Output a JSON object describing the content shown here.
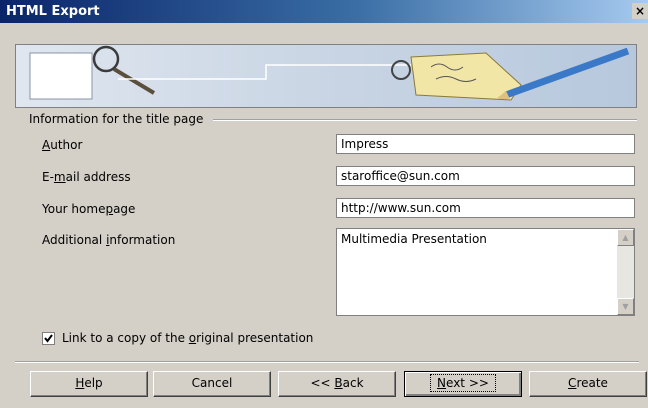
{
  "window": {
    "title": "HTML Export",
    "close_glyph": "×"
  },
  "group": {
    "label": "Information for the title page"
  },
  "fields": {
    "author": {
      "label_accel": "A",
      "label_rest": "uthor",
      "value": "Impress"
    },
    "email": {
      "label_pre": "E-",
      "label_accel": "m",
      "label_rest": "ail address",
      "value": "staroffice@sun.com"
    },
    "homepage": {
      "label_pre": "Your home",
      "label_accel": "p",
      "label_rest": "age",
      "value": "http://www.sun.com"
    },
    "additional": {
      "label_pre": "Additional ",
      "label_accel": "i",
      "label_rest": "nformation",
      "value": "Multimedia Presentation"
    }
  },
  "link_checkbox": {
    "checked": true,
    "label_pre": "Link to a copy of the ",
    "label_accel": "o",
    "label_rest": "riginal presentation"
  },
  "buttons": {
    "help": {
      "accel": "H",
      "rest": "elp"
    },
    "cancel": {
      "label": "Cancel"
    },
    "back": {
      "pre": "<< ",
      "accel": "B",
      "rest": "ack"
    },
    "next": {
      "accel": "N",
      "rest": "ext >>"
    },
    "create": {
      "accel": "C",
      "rest": "reate"
    }
  },
  "colors": {
    "dialog_bg": "#d4d0c8",
    "title_start": "#0a246a",
    "title_end": "#a6caf0"
  },
  "icons": {
    "banner": "magnifier-and-tag-illustration",
    "check": "checkmark-icon",
    "scroll_up": "scroll-up-arrow-icon",
    "scroll_down": "scroll-down-arrow-icon"
  }
}
